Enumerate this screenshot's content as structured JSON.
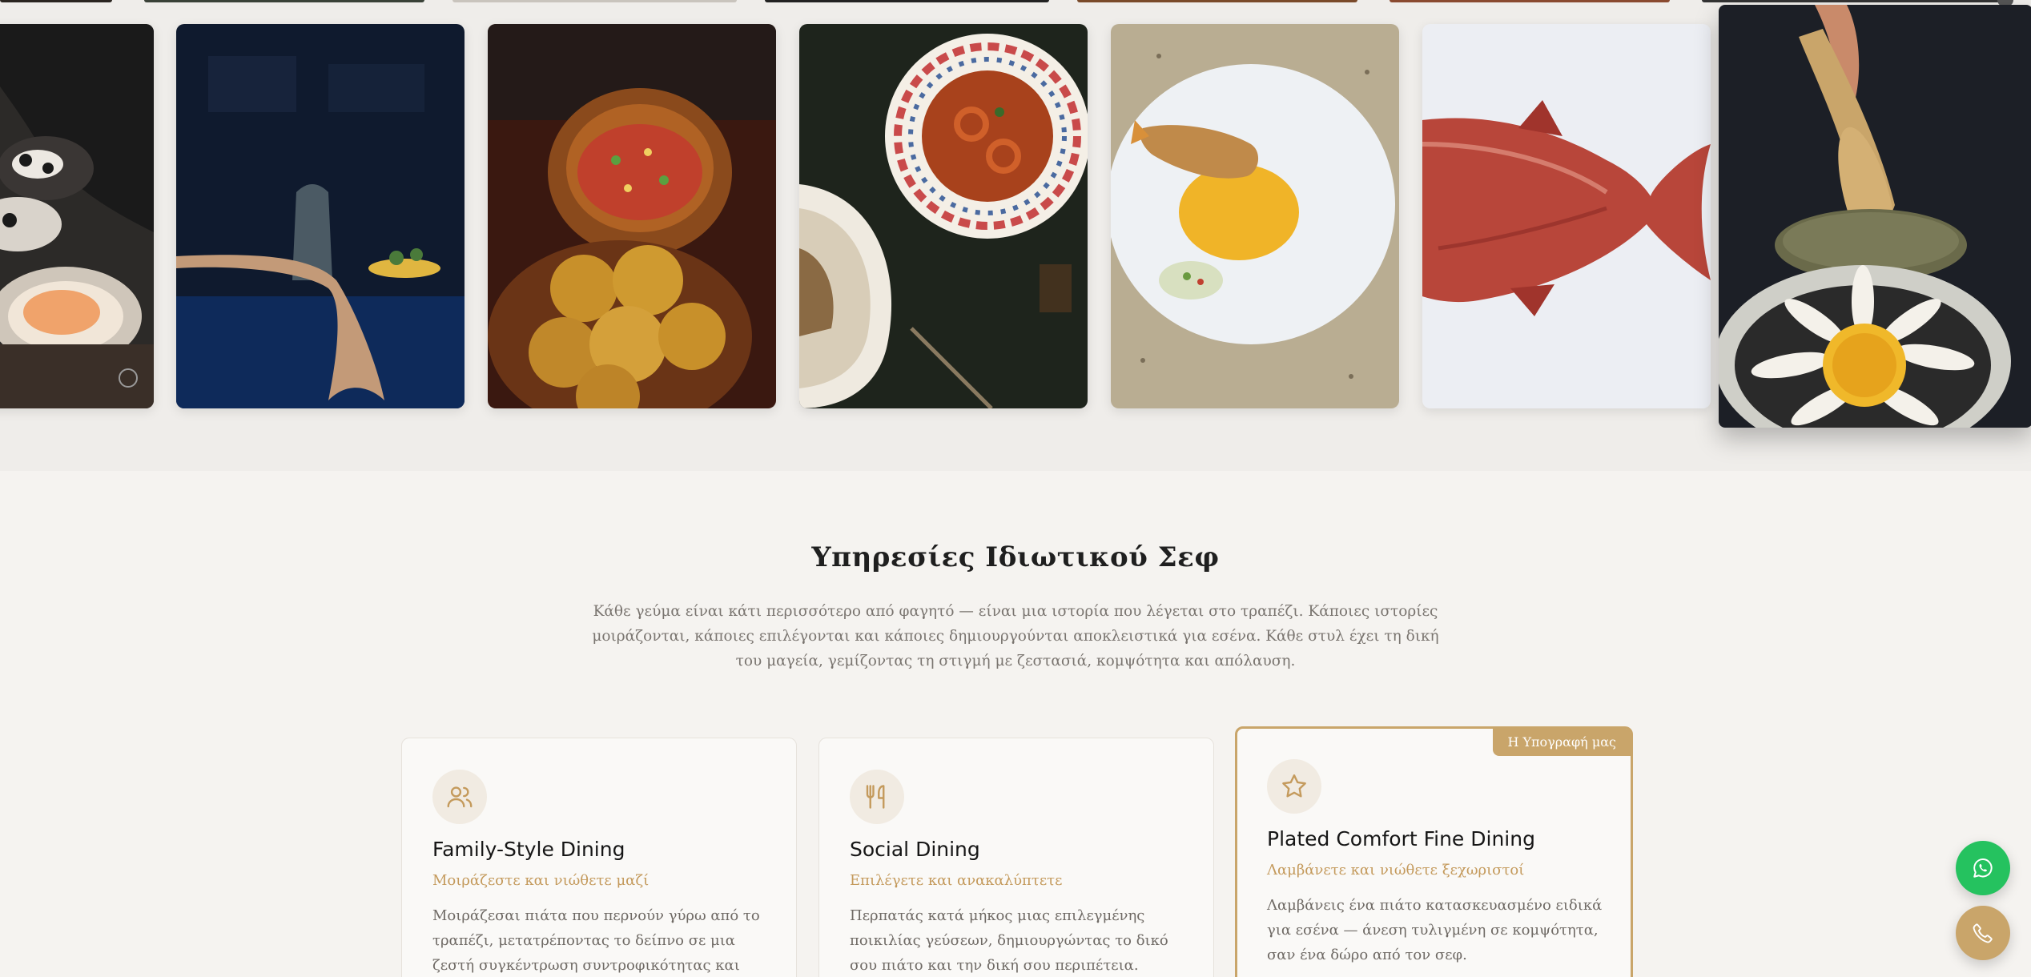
{
  "gallery": {
    "photos": [
      {
        "icon": "oysters-photo"
      },
      {
        "icon": "fish-tail-on-table-photo"
      },
      {
        "icon": "salsa-and-buns-photo"
      },
      {
        "icon": "squid-stew-plate-photo"
      },
      {
        "icon": "fried-fish-fine-dining-photo"
      },
      {
        "icon": "red-snapper-photo"
      },
      {
        "icon": "egg-yolk-flower-dish-photo"
      }
    ]
  },
  "services": {
    "title": "Υπηρεσίες Ιδιωτικού Σεφ",
    "intro": "Κάθε γεύμα είναι κάτι περισσότερο από φαγητό — είναι μια ιστορία που λέγεται στο τραπέζι. Κάποιες ιστορίες μοιράζονται, κάποιες επιλέγονται και κάποιες δημιουργούνται αποκλειστικά για εσένα. Κάθε στυλ έχει τη δική του μαγεία, γεμίζοντας τη στιγμή με ζεστασιά, κομψότητα και απόλαυση.",
    "cards": [
      {
        "icon": "users-icon",
        "title": "Family-Style Dining",
        "subtitle": "Μοιράζεστε και νιώθετε μαζί",
        "body": "Μοιράζεσαι πιάτα που περνούν γύρω από το τραπέζι, μετατρέποντας το δείπνο σε μια ζεστή συγκέντρωση συντροφικότητας και χαράς."
      },
      {
        "icon": "utensils-icon",
        "title": "Social Dining",
        "subtitle": "Επιλέγετε και ανακαλύπτετε",
        "body": "Περπατάς κατά μήκος μιας επιλεγμένης ποικιλίας γεύσεων, δημιουργώντας το δικό σου πιάτο και την δική σου περιπέτεια."
      },
      {
        "icon": "star-icon",
        "badge": "Η Υπογραφή μας",
        "title": "Plated Comfort Fine Dining",
        "subtitle": "Λαμβάνετε και νιώθετε ξεχωριστοί",
        "body": "Λαμβάνεις ένα πιάτο κατασκευασμένο ειδικά για εσένα — άνεση τυλιγμένη σε κομψότητα, σαν ένα δώρο από τον σεφ."
      }
    ]
  },
  "floating": {
    "whatsapp_icon": "whatsapp-icon",
    "phone_icon": "phone-icon"
  },
  "colors": {
    "background": "#f5f3f0",
    "accent_gold": "#c9a56a",
    "whatsapp_green": "#25c25f"
  }
}
